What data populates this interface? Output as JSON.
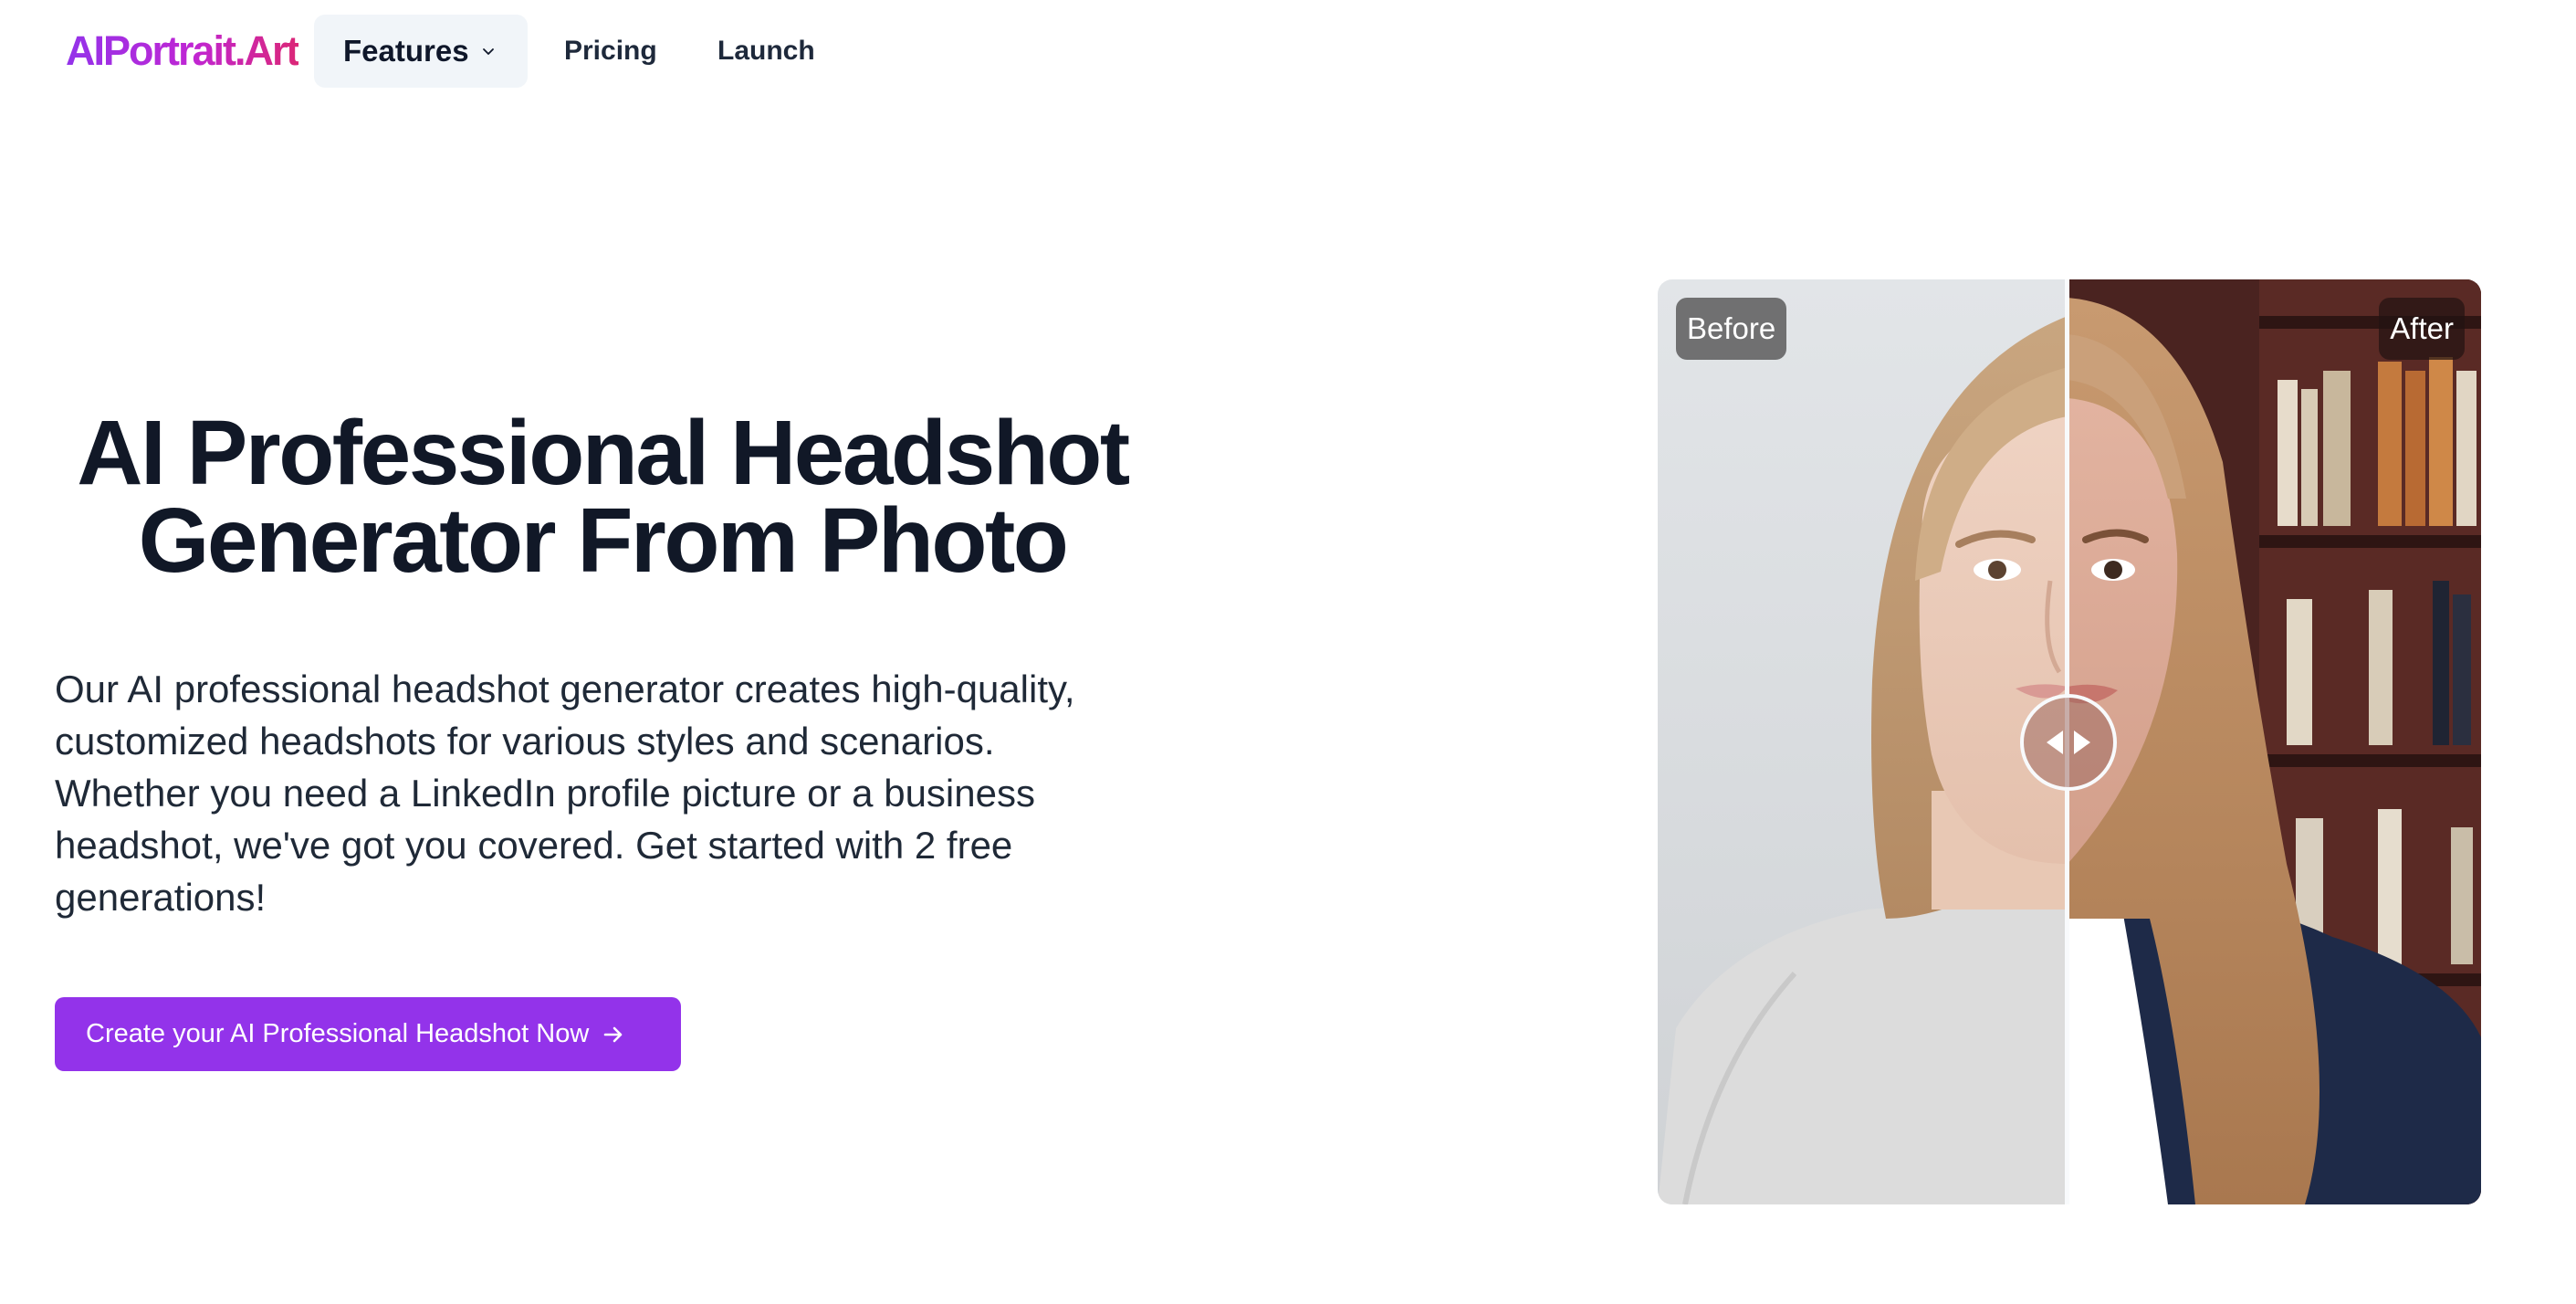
{
  "nav": {
    "logo": "AIPortrait.Art",
    "features_label": "Features",
    "pricing_label": "Pricing",
    "launch_label": "Launch"
  },
  "hero": {
    "title_line1": "AI Professional Headshot",
    "title_line2": "Generator From Photo",
    "description_lines": [
      "Our AI professional headshot generator creates high-quality,",
      "customized headshots for various styles and scenarios.",
      "Whether you need a LinkedIn profile picture or a business",
      "headshot, we've got you covered. Get started with 2 free",
      "generations!"
    ],
    "cta_label": "Create your AI Professional Headshot Now"
  },
  "comparison": {
    "before_label": "Before",
    "after_label": "After",
    "slider_position": 0.5
  },
  "colors": {
    "accent": "#9333ea",
    "logo_gradient_start": "#9333ea",
    "logo_gradient_end": "#db2777",
    "features_bg": "#f1f5f9",
    "heading": "#111827"
  },
  "icons": {
    "features_dropdown": "chevron-down-icon",
    "cta_arrow": "arrow-right-icon",
    "slider_handle": "left-right-arrows-icon"
  }
}
